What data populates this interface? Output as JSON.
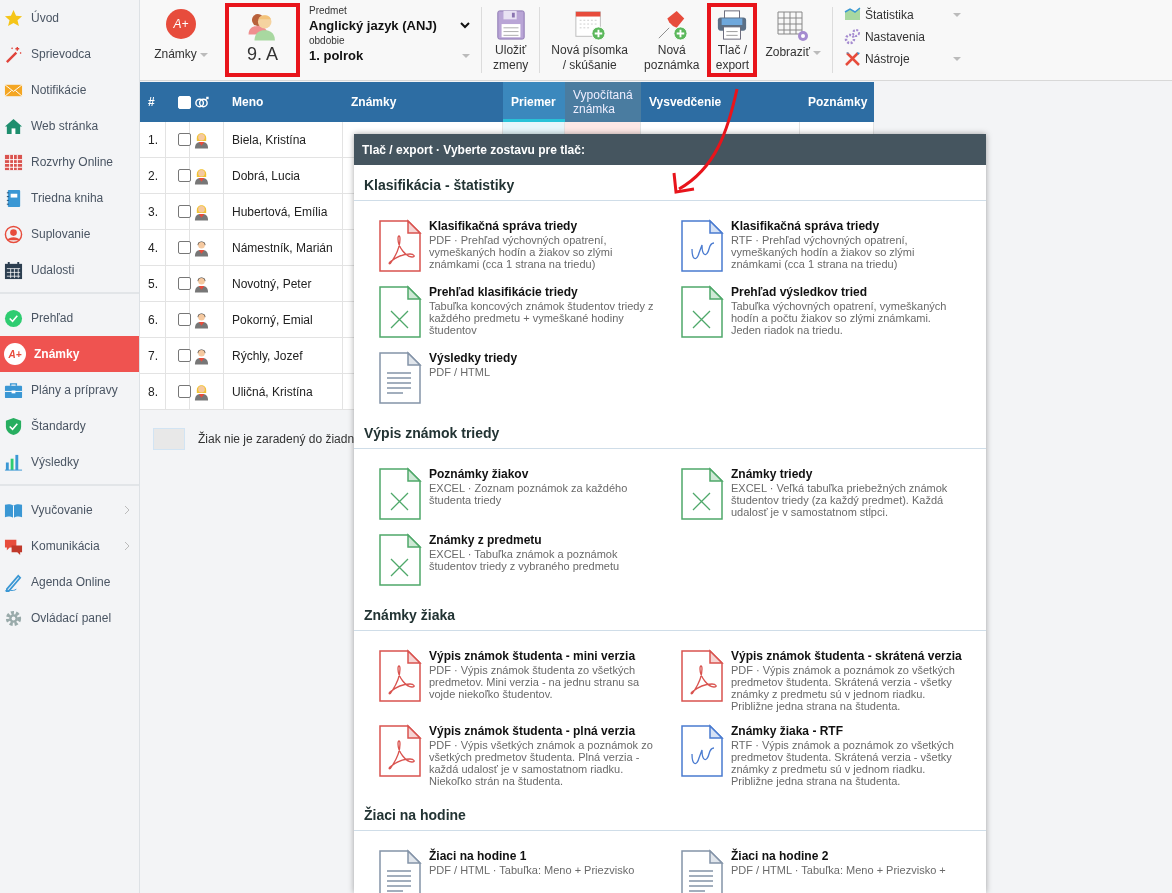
{
  "sidebar": {
    "groups": [
      {
        "items": [
          {
            "label": "Úvod",
            "selected": false,
            "has_submenu": false
          },
          {
            "label": "Sprievodca",
            "selected": false,
            "has_submenu": false
          },
          {
            "label": "Notifikácie",
            "selected": false,
            "has_submenu": false
          },
          {
            "label": "Web stránka",
            "selected": false,
            "has_submenu": false
          },
          {
            "label": "Rozvrhy Online",
            "selected": false,
            "has_submenu": false
          },
          {
            "label": "Triedna kniha",
            "selected": false,
            "has_submenu": false
          },
          {
            "label": "Suplovanie",
            "selected": false,
            "has_submenu": false
          },
          {
            "label": "Udalosti",
            "selected": false,
            "has_submenu": false
          }
        ]
      },
      {
        "items": [
          {
            "label": "Prehľad",
            "selected": false,
            "has_submenu": false
          },
          {
            "label": "Známky",
            "selected": true,
            "has_submenu": false,
            "icon_text": "A+"
          },
          {
            "label": "Plány a prípravy",
            "selected": false,
            "has_submenu": false
          },
          {
            "label": "Štandardy",
            "selected": false,
            "has_submenu": false
          },
          {
            "label": "Výsledky",
            "selected": false,
            "has_submenu": false
          }
        ]
      },
      {
        "items": [
          {
            "label": "Vyučovanie",
            "selected": false,
            "has_submenu": true
          },
          {
            "label": "Komunikácia",
            "selected": false,
            "has_submenu": true
          },
          {
            "label": "Agenda Online",
            "selected": false,
            "has_submenu": false
          },
          {
            "label": "Ovládací panel",
            "selected": false,
            "has_submenu": false
          }
        ]
      }
    ]
  },
  "toolbar": {
    "grades_menu": {
      "label": "Známky",
      "icon_text": "A+"
    },
    "class_selector": {
      "label": "9. A",
      "highlighted": true
    },
    "subject": {
      "label": "Predmet",
      "value": "Anglický jazyk (ANJ)"
    },
    "period": {
      "label": "obdobie",
      "value": "1. polrok"
    },
    "buttons": [
      {
        "kind": "save",
        "label": "Uložiť\nzmeny",
        "highlighted": false,
        "has_menu": false
      },
      {
        "kind": "test",
        "label": "Nová písomka\n/ skúšanie",
        "highlighted": false,
        "has_menu": false
      },
      {
        "kind": "note",
        "label": "Nová\npoznámka",
        "highlighted": false,
        "has_menu": false
      },
      {
        "kind": "print",
        "label": "Tlač /\nexport",
        "highlighted": true,
        "has_menu": false
      },
      {
        "kind": "view",
        "label": "Zobraziť",
        "highlighted": false,
        "has_menu": true
      }
    ],
    "side_menu": [
      {
        "kind": "chart",
        "label": "Štatistika",
        "has_menu": true
      },
      {
        "kind": "gears",
        "label": "Nastavenia",
        "has_menu": false
      },
      {
        "kind": "tools",
        "label": "Nástroje",
        "has_menu": true
      }
    ]
  },
  "table": {
    "header_checkbox": {
      "checked": false
    },
    "columns": [
      {
        "kind": "number",
        "label": "#"
      },
      {
        "kind": "check"
      },
      {
        "kind": "gender"
      },
      {
        "kind": "plain",
        "label": "Meno"
      },
      {
        "kind": "plain",
        "label": "Známky"
      },
      {
        "kind": "average",
        "label": "Priemer"
      },
      {
        "kind": "computed",
        "label": "Vypočítaná známka"
      },
      {
        "kind": "plain",
        "label": "Vysvedčenie"
      },
      {
        "kind": "plain",
        "label": "Poznámky"
      }
    ],
    "rows": [
      {
        "number": "1.",
        "checked": false,
        "kind": "female",
        "name": "Biela, Kristína"
      },
      {
        "number": "2.",
        "checked": false,
        "kind": "female",
        "name": "Dobrá, Lucia"
      },
      {
        "number": "3.",
        "checked": false,
        "kind": "female",
        "name": "Hubertová, Emília"
      },
      {
        "number": "4.",
        "checked": false,
        "kind": "male",
        "name": "Námestník, Marián"
      },
      {
        "number": "5.",
        "checked": false,
        "kind": "male",
        "name": "Novotný, Peter"
      },
      {
        "number": "6.",
        "checked": false,
        "kind": "male",
        "name": "Pokorný, Emial"
      },
      {
        "number": "7.",
        "checked": false,
        "kind": "male",
        "name": "Rýchly, Jozef"
      },
      {
        "number": "8.",
        "checked": false,
        "kind": "female",
        "name": "Uličná, Kristína"
      }
    ],
    "legend": "Žiak nie je zaradený do žiadn"
  },
  "export_dialog": {
    "title": "Tlač / export · Vyberte zostavu pre tlač:",
    "sections": [
      {
        "title": "Klasifikácia - štatistiky",
        "items": [
          {
            "kind": "pdf",
            "title": "Klasifikačná správa triedy",
            "desc": "PDF · Prehľad výchovných opatrení, vymeškaných hodín a žiakov so zlými známkami (cca 1 strana na triedu)"
          },
          {
            "kind": "rtf",
            "title": "Klasifikačná správa triedy",
            "desc": "RTF · Prehľad výchovných opatrení, vymeškaných hodín a žiakov so zlými známkami (cca 1 strana na triedu)"
          },
          {
            "kind": "excel",
            "title": "Prehľad klasifikácie triedy",
            "desc": "Tabuľka koncových známok študentov triedy z každého predmetu + vymeškané hodiny študentov"
          },
          {
            "kind": "excel",
            "title": "Prehľad výsledkov tried",
            "desc": "Tabuľka výchovných opatrení, vymeškaných hodín a počtu žiakov so zlými známkami. Jeden riadok na triedu."
          },
          {
            "kind": "doc",
            "title": "Výsledky triedy",
            "desc": "PDF / HTML"
          }
        ]
      },
      {
        "title": "Výpis známok triedy",
        "items": [
          {
            "kind": "excel",
            "title": "Poznámky žiakov",
            "desc": "EXCEL · Zoznam poznámok za každého študenta triedy"
          },
          {
            "kind": "excel",
            "title": "Známky triedy",
            "desc": "EXCEL · Veľká tabuľka priebežných známok študentov triedy (za každý predmet). Každá udalosť je v samostatnom stĺpci."
          },
          {
            "kind": "excel",
            "title": "Známky z predmetu",
            "desc": "EXCEL · Tabuľka známok a poznámok študentov triedy z vybraného predmetu"
          }
        ]
      },
      {
        "title": "Známky žiaka",
        "items": [
          {
            "kind": "pdf",
            "title": "Výpis známok študenta - mini verzia",
            "desc": "PDF · Výpis známok študenta zo všetkých predmetov. Mini verzia - na jednu stranu sa vojde niekoľko študentov."
          },
          {
            "kind": "pdf",
            "title": "Výpis známok študenta - skrátená verzia",
            "desc": "PDF · Výpis známok a poznámok zo všetkých predmetov študenta. Skrátená verzia - všetky známky z predmetu sú v jednom riadku. Približne jedna strana na študenta."
          },
          {
            "kind": "pdf",
            "title": "Výpis známok študenta - plná verzia",
            "desc": "PDF · Výpis všetkých známok a poznámok zo všetkých predmetov študenta. Plná verzia - každá udalosť je v samostatnom riadku. Niekoľko strán na študenta."
          },
          {
            "kind": "rtf",
            "title": "Známky žiaka - RTF",
            "desc": "RTF · Výpis známok a poznámok zo všetkých predmetov študenta. Skrátená verzia - všetky známky z predmetu sú v jednom riadku. Približne jedna strana na študenta."
          }
        ]
      },
      {
        "title": "Žiaci na hodine",
        "items": [
          {
            "kind": "doc",
            "title": "Žiaci na hodine 1",
            "desc": "PDF / HTML · Tabuľka: Meno + Priezvisko"
          },
          {
            "kind": "doc",
            "title": "Žiaci na hodine 2",
            "desc": "PDF / HTML · Tabuľka: Meno + Priezvisko +"
          }
        ]
      }
    ]
  }
}
